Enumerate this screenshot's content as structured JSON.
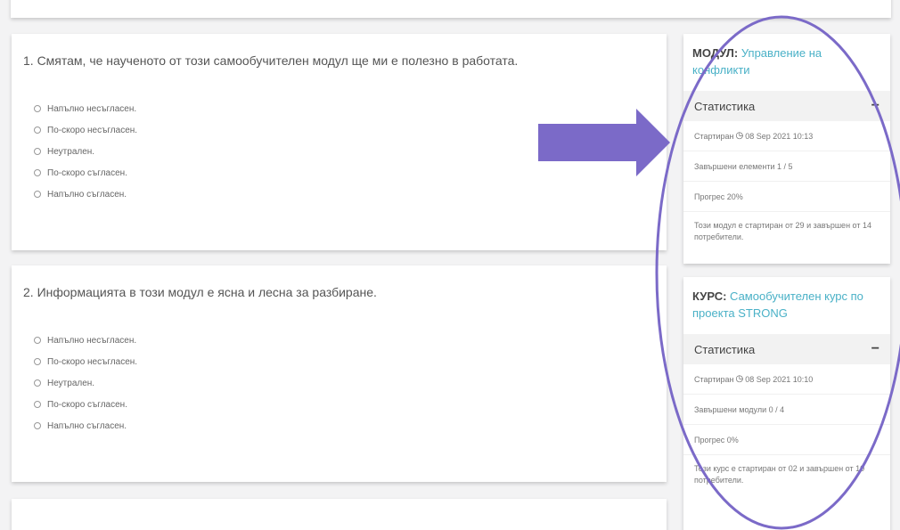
{
  "questions": [
    {
      "title": "1. Смятам, че наученото от този самообучителен модул ще ми е полезно в работата.",
      "options": [
        "Напълно несъгласен.",
        "По-скоро несъгласен.",
        "Неутрален.",
        "По-скоро съгласен.",
        "Напълно съгласен."
      ]
    },
    {
      "title": "2. Информацията в този модул е ясна и лесна за разбиране.",
      "options": [
        "Напълно несъгласен.",
        "По-скоро несъгласен.",
        "Неутрален.",
        "По-скоро съгласен.",
        "Напълно съгласен."
      ]
    }
  ],
  "module": {
    "label": "МОДУЛ:",
    "name": "Управление на конфликти",
    "stats_title": "Статистика",
    "toggle": "−",
    "started_label": "Стартиран",
    "started_date": "08 Sep 2021 10:13",
    "completed_elements": "Завършени елементи 1 / 5",
    "progress": "Прогрес 20%",
    "summary": "Този модул е стартиран от 29 и завършен от 14 потребители."
  },
  "course": {
    "label": "КУРС:",
    "name": "Самообучителен курс по проекта STRONG",
    "stats_title": "Статистика",
    "toggle": "−",
    "started_label": "Стартиран",
    "started_date": "08 Sep 2021 10:10",
    "completed_modules": "Завършени модули 0 / 4",
    "progress": "Прогрес 0%",
    "summary": "Този курс е стартиран от 02 и завършен от 10 потребители."
  },
  "colors": {
    "link": "#4ab1c7",
    "annotation": "#7b6ac8"
  }
}
